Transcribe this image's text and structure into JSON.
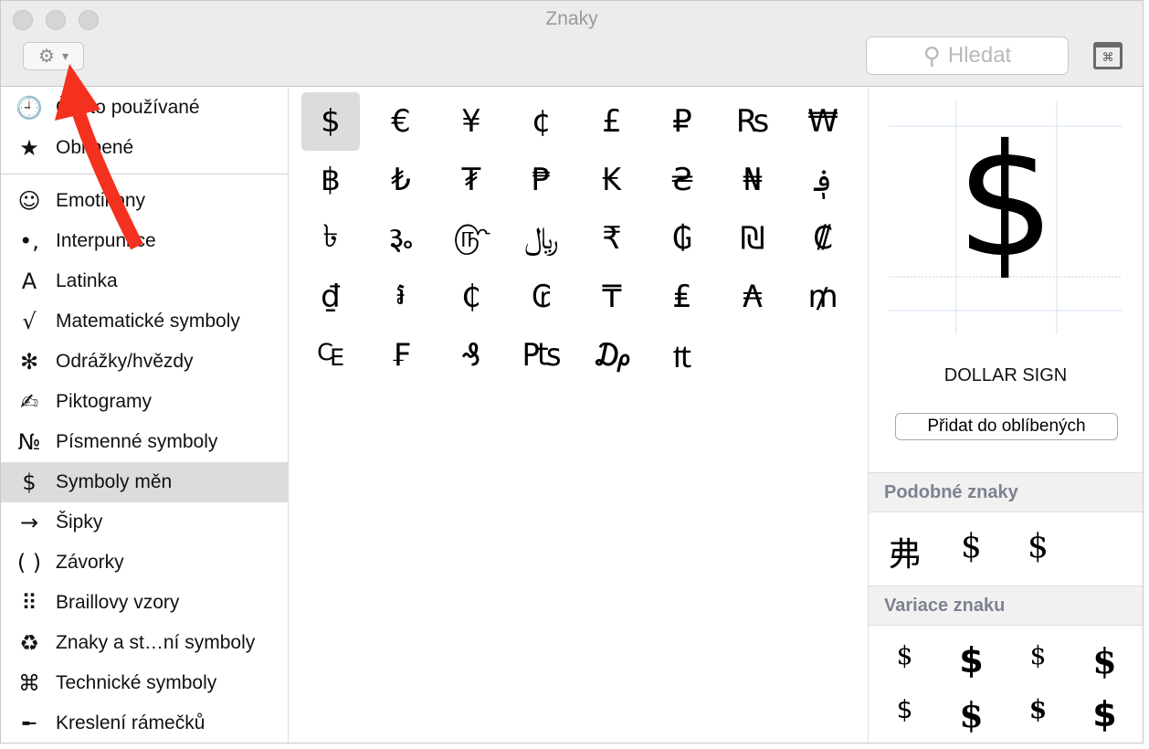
{
  "window": {
    "title": "Znaky"
  },
  "toolbar": {
    "gear_icon": "⚙",
    "chevron": "⌄",
    "search_placeholder": "Hledat",
    "search_icon": "⚲",
    "keyboard_icon": "⌘"
  },
  "sidebar": {
    "top": [
      {
        "icon": "🕘",
        "label": "Často používané"
      },
      {
        "icon": "★",
        "label": "Oblíbené"
      }
    ],
    "items": [
      {
        "icon": "☺",
        "label": "Emotikony"
      },
      {
        "icon": "•,",
        "label": "Interpunkce"
      },
      {
        "icon": "A",
        "label": "Latinka"
      },
      {
        "icon": "√",
        "label": "Matematické symboly"
      },
      {
        "icon": "✻",
        "label": "Odrážky/hvězdy"
      },
      {
        "icon": "✍",
        "label": "Piktogramy"
      },
      {
        "icon": "№",
        "label": "Písmenné symboly"
      },
      {
        "icon": "$",
        "label": "Symboly měn"
      },
      {
        "icon": "→",
        "label": "Šipky"
      },
      {
        "icon": "( )",
        "label": "Závorky"
      },
      {
        "icon": "⠿",
        "label": "Braillovy vzory"
      },
      {
        "icon": "♻",
        "label": "Znaky a st…ní symboly"
      },
      {
        "icon": "⌘",
        "label": "Technické symboly"
      },
      {
        "icon": "╾",
        "label": "Kreslení rámečků"
      }
    ]
  },
  "grid": [
    "$",
    "€",
    "¥",
    "¢",
    "£",
    "₽",
    "₨",
    "₩",
    "฿",
    "₺",
    "₮",
    "₱",
    "₭",
    "₴",
    "₦",
    "؋",
    "৳",
    "૱",
    "௹",
    "﷼",
    "₹",
    "₲",
    "₪",
    "₡",
    "₫",
    "៛",
    "₵",
    "₢",
    "₸",
    "₤",
    "₳",
    "₥",
    "₠",
    "₣",
    "₰",
    "₧",
    "₯",
    "₶"
  ],
  "detail": {
    "char": "$",
    "name": "DOLLAR SIGN",
    "fav_button": "Přidat do oblíbených",
    "similar_title": "Podobné znaky",
    "similar": [
      "弗",
      "$",
      "$"
    ],
    "variants_title": "Variace znaku",
    "variants": [
      "$",
      "$",
      "$",
      "$",
      "$",
      "$",
      "$",
      "$"
    ]
  }
}
